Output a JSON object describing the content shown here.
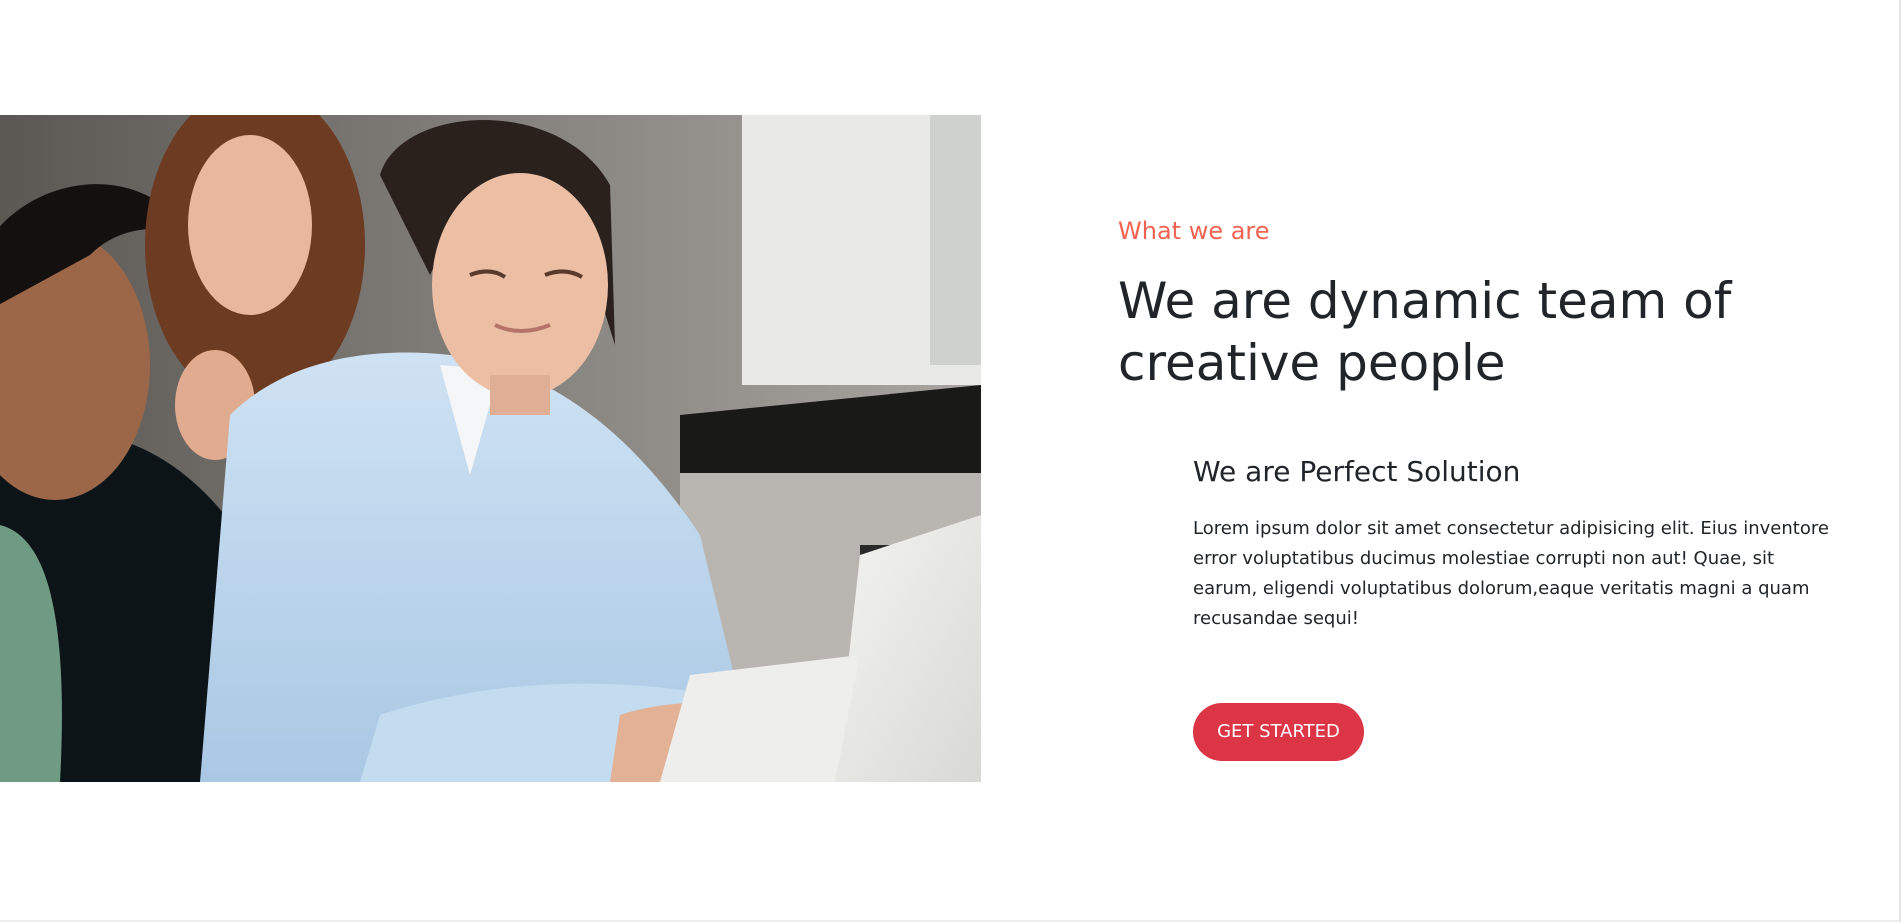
{
  "about": {
    "eyebrow": "What we are",
    "headline": "We are dynamic team of creative people",
    "subheading": "We are Perfect Solution",
    "body": "Lorem ipsum dolor sit amet consectetur adipisicing elit. Eius inventore error voluptatibus ducimus molestiae corrupti non aut! Quae, sit earum, eligendi voluptatibus dolorum,eaque veritatis magni a quam recusandae sequi!",
    "cta_label": "GET STARTED",
    "image_alt": "team-photo"
  },
  "colors": {
    "accent": "#f26352",
    "button": "#dc3545",
    "text": "#212529"
  }
}
